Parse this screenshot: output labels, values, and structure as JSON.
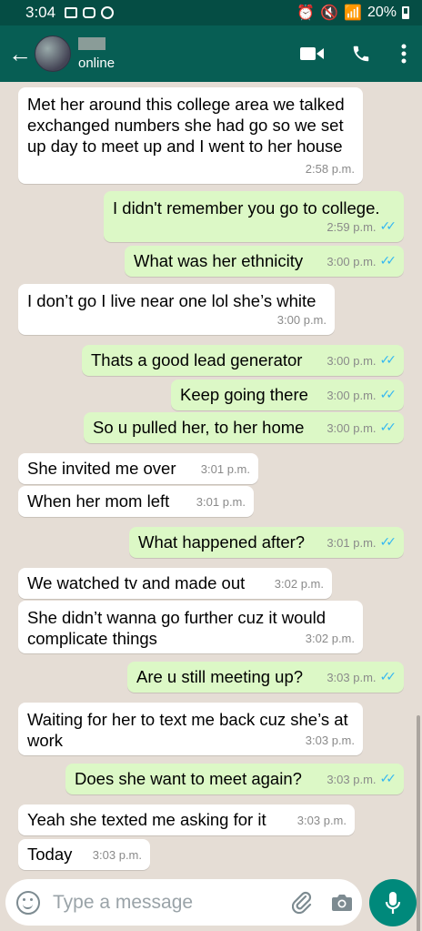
{
  "status_bar": {
    "time": "3:04",
    "battery": "20%"
  },
  "header": {
    "contact_status": "online"
  },
  "composer": {
    "placeholder": "Type a message"
  },
  "messages": [
    {
      "dir": "in",
      "text": "Met her around this college area  we talked exchanged numbers she had go so we set up day to meet up and I went to her house",
      "time": "2:58 p.m."
    },
    {
      "dir": "out",
      "text": "I didn't remember you go to college.",
      "time": "2:59 p.m."
    },
    {
      "dir": "out",
      "text": "What was her ethnicity",
      "time": "3:00 p.m."
    },
    {
      "dir": "in",
      "text": "I don’t go I live near one lol she’s white",
      "time": "3:00 p.m."
    },
    {
      "dir": "out",
      "text": "Thats a good lead generator",
      "time": "3:00 p.m."
    },
    {
      "dir": "out",
      "text": "Keep going there",
      "time": "3:00 p.m."
    },
    {
      "dir": "out",
      "text": "So u pulled her, to her home",
      "time": "3:00 p.m."
    },
    {
      "dir": "in",
      "text": "She invited me over",
      "time": "3:01 p.m."
    },
    {
      "dir": "in",
      "text": "When her mom left",
      "time": "3:01 p.m."
    },
    {
      "dir": "out",
      "text": "What happened after?",
      "time": "3:01 p.m."
    },
    {
      "dir": "in",
      "text": "We watched tv and made out",
      "time": "3:02 p.m."
    },
    {
      "dir": "in",
      "text": "She didn’t wanna go further cuz it would complicate things",
      "time": "3:02 p.m."
    },
    {
      "dir": "out",
      "text": "Are u still meeting up?",
      "time": "3:03 p.m."
    },
    {
      "dir": "in",
      "text": "Waiting for her to text me back cuz she’s at work",
      "time": "3:03 p.m."
    },
    {
      "dir": "out",
      "text": "Does she want to meet again?",
      "time": "3:03 p.m."
    },
    {
      "dir": "in",
      "text": "Yeah she texted me asking for it",
      "time": "3:03 p.m."
    },
    {
      "dir": "in",
      "text": "Today",
      "time": "3:03 p.m."
    }
  ]
}
